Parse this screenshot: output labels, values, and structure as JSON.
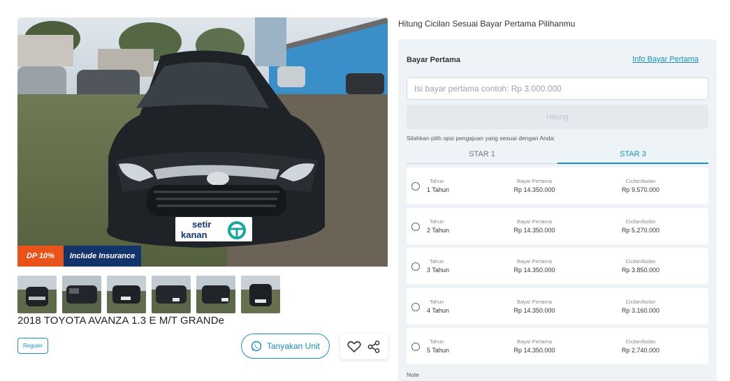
{
  "gallery": {
    "badge_dp": "DP 10%",
    "badge_insurance": "Include Insurance",
    "brand_logo": "setir kanan",
    "brand_logo_line1": "setir",
    "brand_logo_line2": "kanan",
    "thumbnail_count": 6
  },
  "listing": {
    "title": "2018 TOYOTA AVANZA 1.3 E M/T GRANDe",
    "tag": "Reguler",
    "ask_button": "Tanyakan Unit",
    "icons": {
      "ask": "whatsapp-icon",
      "favorite": "heart-icon",
      "share": "share-icon"
    }
  },
  "calculator": {
    "heading": "Hitung Cicilan Sesuai Bayar Pertama Pilihanmu",
    "down_payment_label": "Bayar Pertama",
    "info_link": "Info Bayar Pertama",
    "input_value": "",
    "input_placeholder": "Isi bayar pertama contoh: Rp 3.000.000",
    "submit_label": "Hitung",
    "hint": "Silahkan pilih opsi pengajuan yang sesuai dengan Anda:",
    "tabs": [
      {
        "label": "STAR 1",
        "active": false
      },
      {
        "label": "STAR 3",
        "active": true
      }
    ],
    "column_labels": {
      "tenor": "Tahun",
      "dp": "Bayar Pertama",
      "installment": "Cicilan/bulan"
    },
    "options": [
      {
        "tenor": "1 Tahun",
        "dp": "Rp 14.350.000",
        "installment": "Rp 9.570.000"
      },
      {
        "tenor": "2 Tahun",
        "dp": "Rp 14.350.000",
        "installment": "Rp 5.270.000"
      },
      {
        "tenor": "3 Tahun",
        "dp": "Rp 14.350.000",
        "installment": "Rp 3.850.000"
      },
      {
        "tenor": "4 Tahun",
        "dp": "Rp 14.350.000",
        "installment": "Rp 3.160.000"
      },
      {
        "tenor": "5 Tahun",
        "dp": "Rp 14.350.000",
        "installment": "Rp 2.740.000"
      }
    ],
    "note_label": "Note"
  },
  "colors": {
    "accent": "#1a8fb5",
    "dp_badge": "#e8521b",
    "insurance_badge": "#13336b",
    "panel_bg": "#eef3f7"
  }
}
